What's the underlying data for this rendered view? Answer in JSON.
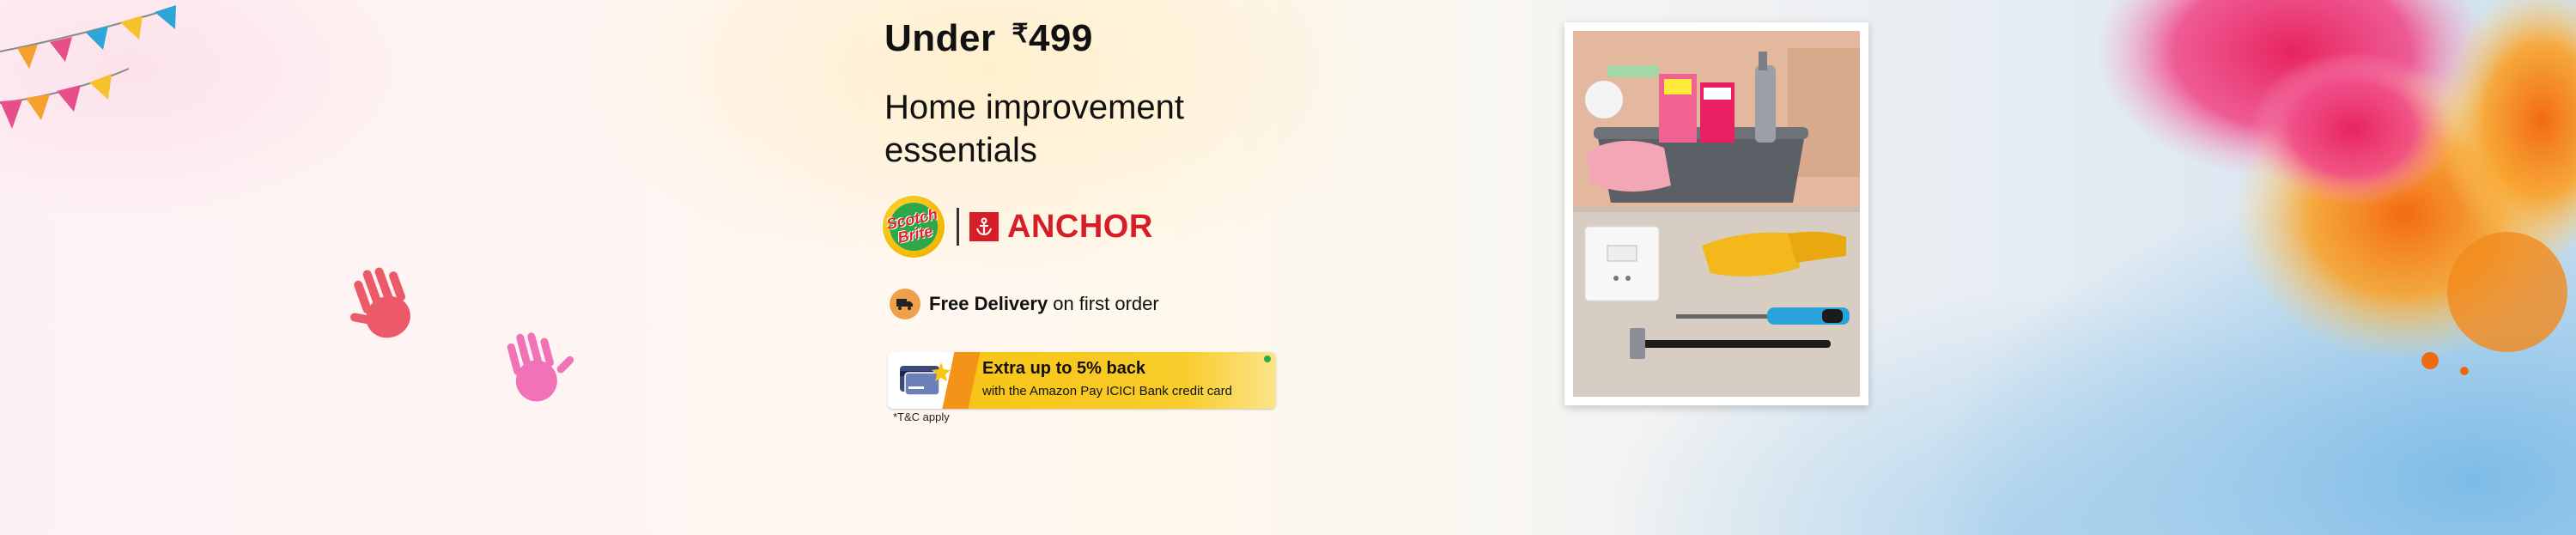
{
  "headline": {
    "prefix": "Under",
    "currency": "₹",
    "amount": "499"
  },
  "subheadline": "Home improvement essentials",
  "brands": {
    "brand1": "Scotch Brite",
    "brand2": "ANCHOR"
  },
  "delivery": {
    "bold": "Free Delivery",
    "rest": "on first order"
  },
  "offer": {
    "title": "Extra up to 5% back",
    "text": "with the Amazon Pay ICICI Bank credit card"
  },
  "tnc": "*T&C apply",
  "colors": {
    "anchor_red": "#d71e28",
    "offer_yellow": "#f7c516",
    "offer_orange": "#f39318"
  }
}
